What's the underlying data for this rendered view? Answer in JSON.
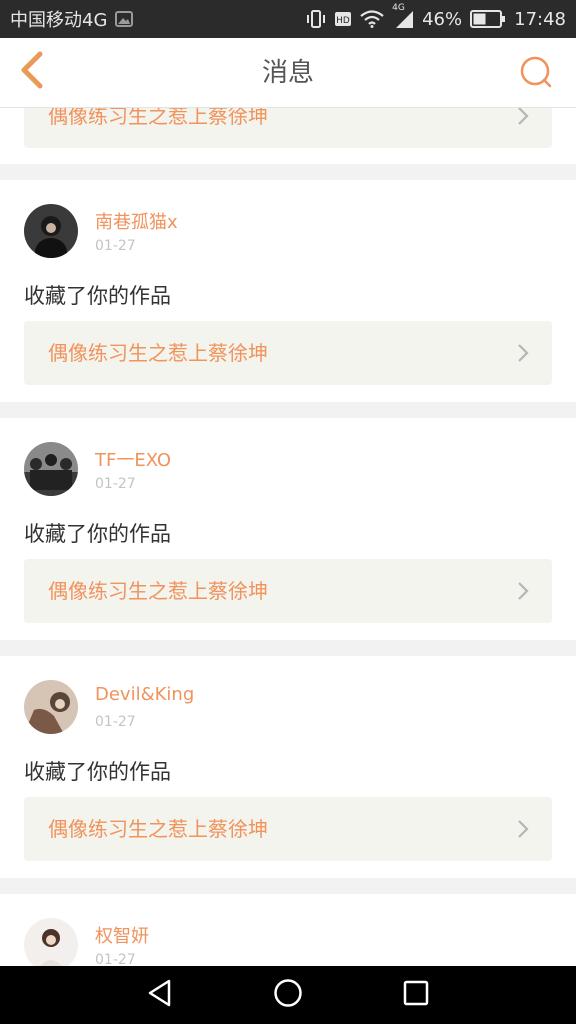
{
  "status_bar": {
    "carrier": "中国移动4G",
    "network_label": "4G",
    "battery": "46%",
    "time": "17:48"
  },
  "header": {
    "title": "消息"
  },
  "colors": {
    "accent": "#f0935c",
    "background": "#f2f2f2",
    "card": "#ffffff",
    "work_bg": "#f4f4ee"
  },
  "partial_top": {
    "work_title": "偶像练习生之惹上蔡徐坤"
  },
  "notifications": [
    {
      "username": "南巷孤猫x",
      "date": "01-27",
      "action": "收藏了你的作品",
      "work_title": "偶像练习生之惹上蔡徐坤"
    },
    {
      "username": "TF一EXO",
      "date": "01-27",
      "action": "收藏了你的作品",
      "work_title": "偶像练习生之惹上蔡徐坤"
    },
    {
      "username": "Devil&King",
      "date": "01-27",
      "action": "收藏了你的作品",
      "work_title": "偶像练习生之惹上蔡徐坤"
    }
  ],
  "partial_bottom": {
    "username": "权智妍",
    "date": "01-27"
  }
}
